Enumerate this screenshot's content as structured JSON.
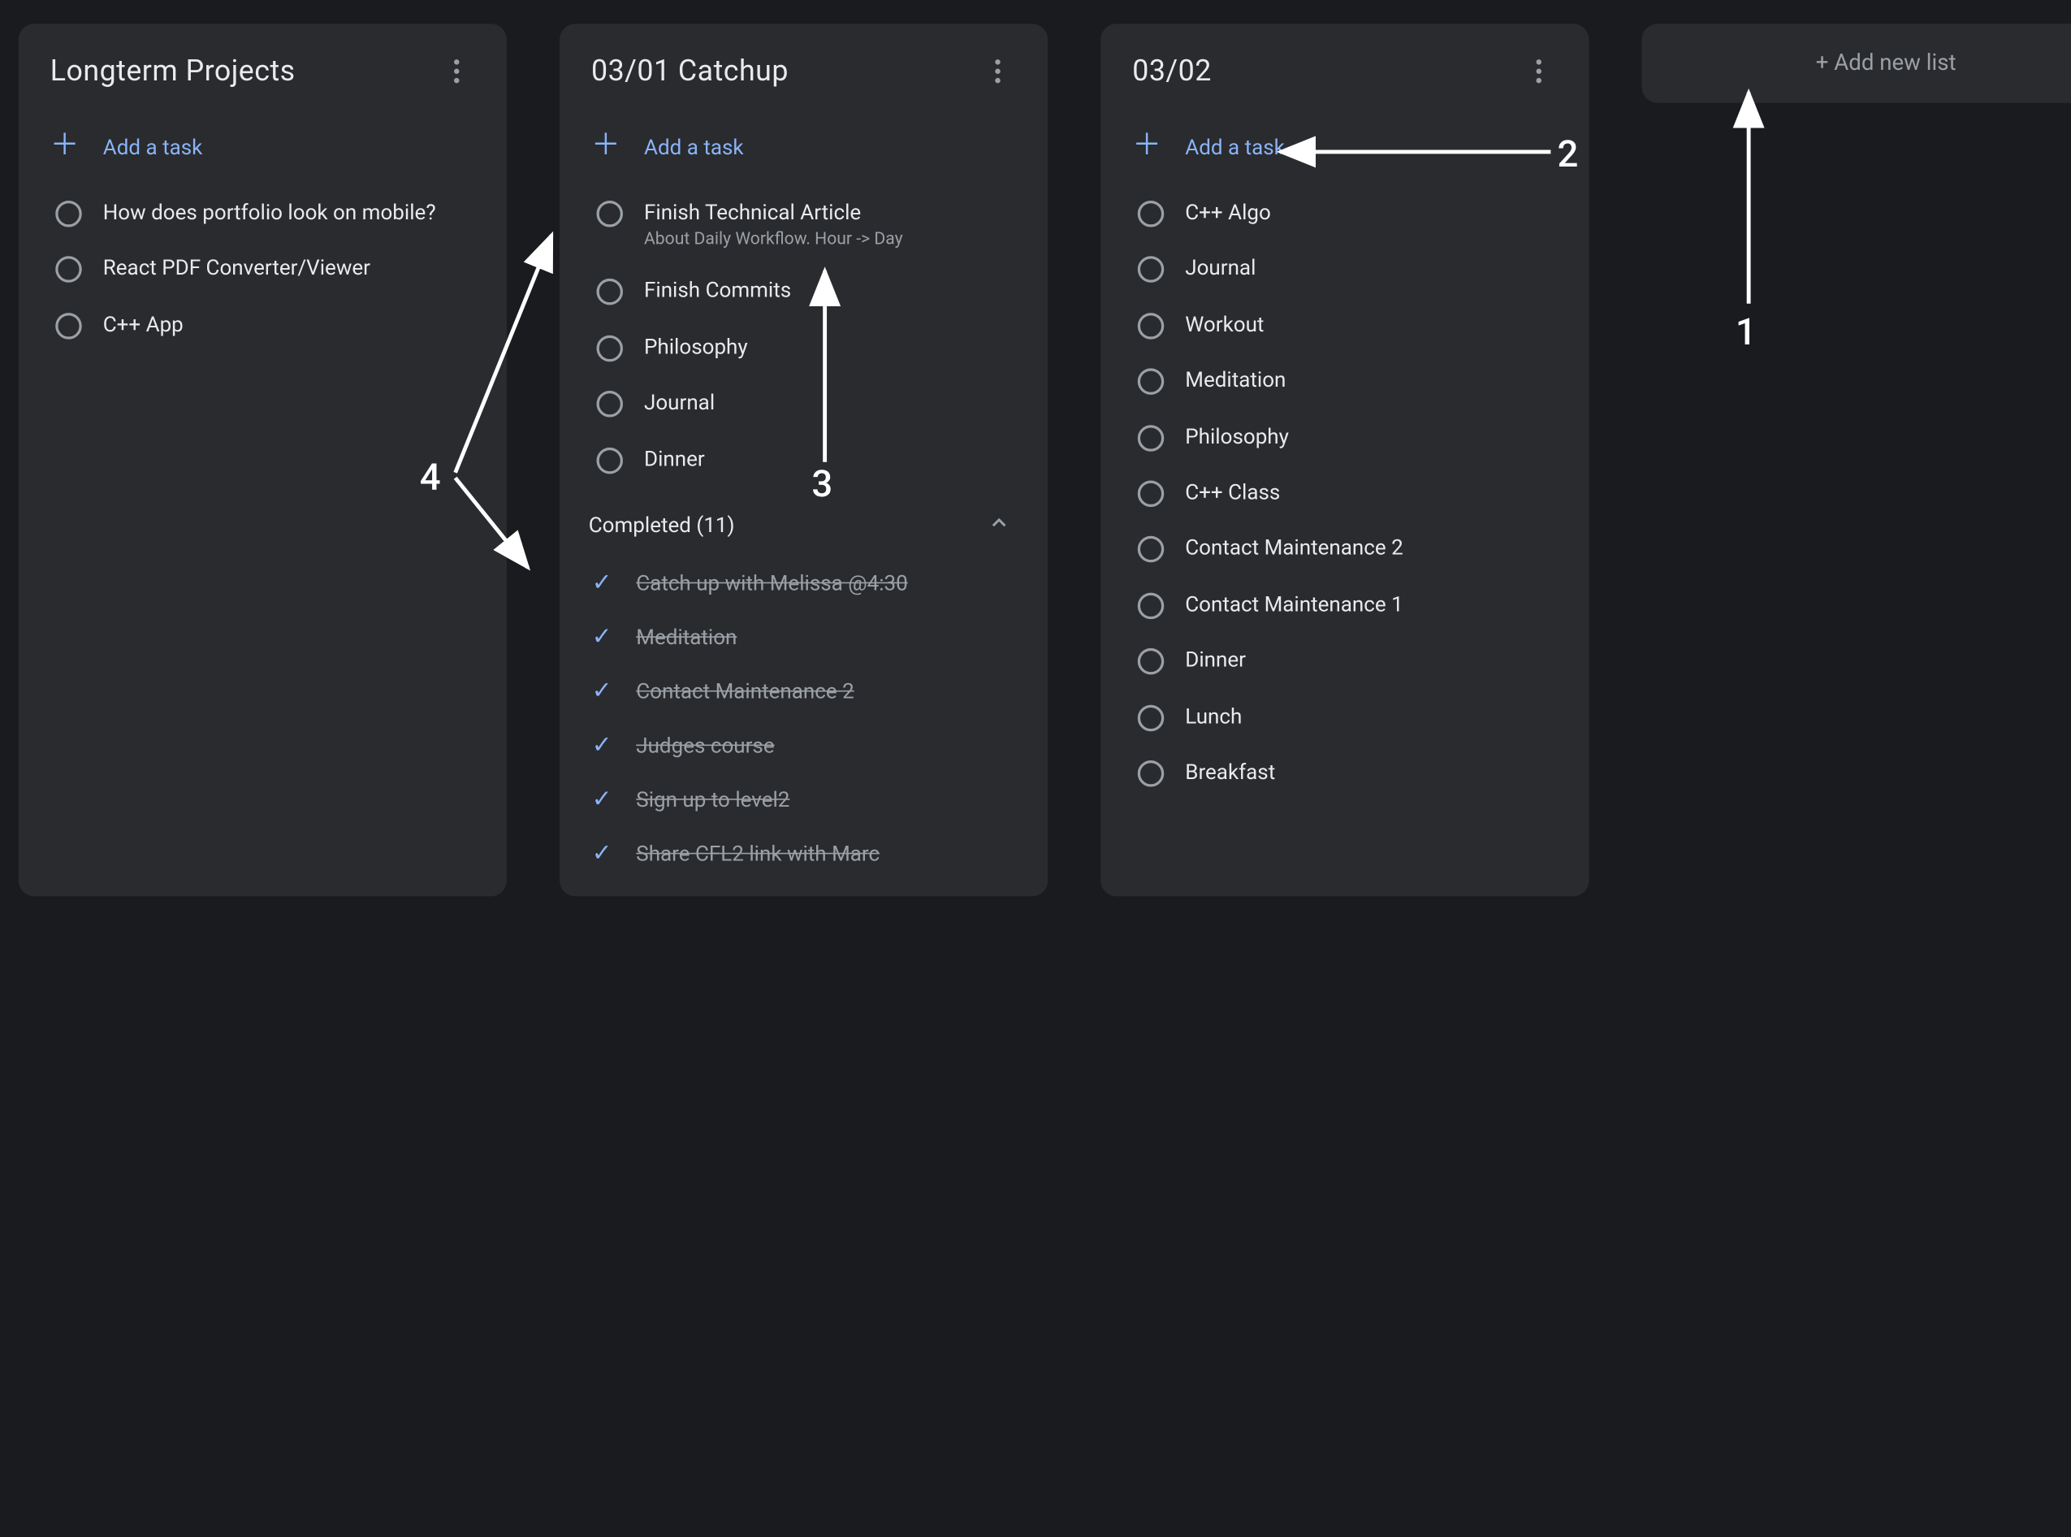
{
  "lists": [
    {
      "title": "Longterm Projects",
      "add_label": "Add a task",
      "tasks": [
        {
          "text": "How does portfolio look on mobile?"
        },
        {
          "text": "React PDF Converter/Viewer"
        },
        {
          "text": "C++ App"
        }
      ]
    },
    {
      "title": "03/01 Catchup",
      "add_label": "Add a task",
      "tasks": [
        {
          "text": "Finish Technical Article",
          "sub": "About Daily Workflow. Hour -> Day"
        },
        {
          "text": "Finish Commits"
        },
        {
          "text": "Philosophy"
        },
        {
          "text": "Journal"
        },
        {
          "text": "Dinner"
        }
      ],
      "completed_label": "Completed (11)",
      "completed": [
        {
          "text": "Catch up with Melissa @4:30"
        },
        {
          "text": "Meditation"
        },
        {
          "text": "Contact Maintenance 2"
        },
        {
          "text": "Judges course"
        },
        {
          "text": "Sign up to level2"
        },
        {
          "text": "Share CFL2 link with Marc"
        }
      ]
    },
    {
      "title": "03/02",
      "add_label": "Add a task",
      "tasks": [
        {
          "text": "C++ Algo"
        },
        {
          "text": "Journal"
        },
        {
          "text": "Workout"
        },
        {
          "text": "Meditation"
        },
        {
          "text": "Philosophy"
        },
        {
          "text": "C++ Class"
        },
        {
          "text": "Contact Maintenance 2"
        },
        {
          "text": "Contact Maintenance 1"
        },
        {
          "text": "Dinner"
        },
        {
          "text": "Lunch"
        },
        {
          "text": "Breakfast"
        }
      ]
    }
  ],
  "add_list_label": "+ Add new list",
  "annotations": {
    "n1": "1",
    "n2": "2",
    "n3": "3",
    "n4": "4"
  }
}
